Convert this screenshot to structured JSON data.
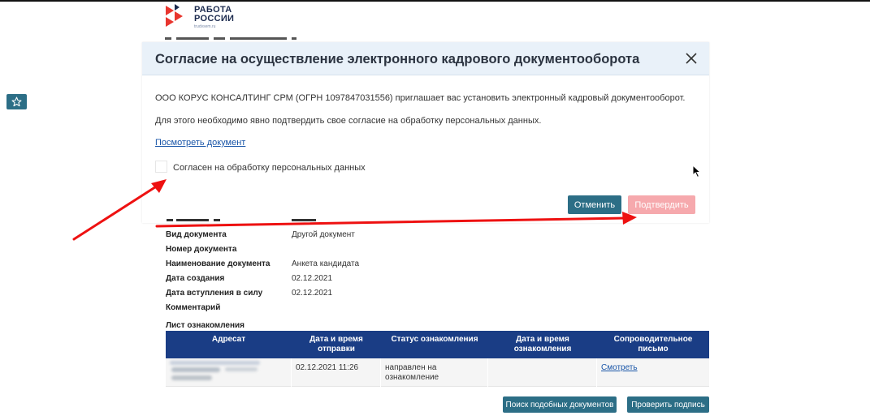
{
  "logo": {
    "line1": "РАБОТА",
    "line2": "РОССИИ",
    "sub": "trudvsem.ru"
  },
  "modal": {
    "title": "Согласие на осуществление электронного кадрового документооборота",
    "line1": "ООО КОРУС КОНСАЛТИНГ СРМ (ОГРН 1097847031556) приглашает вас установить электронный кадровый документооборот.",
    "line2": "Для этого необходимо явно подтвердить свое согласие на обработку персональных данных.",
    "link": "Посмотреть документ",
    "checkbox_label": "Согласен на обработку персональных данных",
    "checkbox_checked": false,
    "cancel_label": "Отменить",
    "confirm_label": "Подтвердить",
    "confirm_color": "#f6a9ad",
    "icons": [
      "close-icon",
      "star-icon",
      "mouse-cursor-icon"
    ]
  },
  "document": {
    "fields": [
      {
        "label": "Вид документа",
        "value": "Другой документ"
      },
      {
        "label": "Номер документа",
        "value": ""
      },
      {
        "label": "Наименование документа",
        "value": "Анкета кандидата"
      },
      {
        "label": "Дата создания",
        "value": "02.12.2021"
      },
      {
        "label": "Дата вступления в силу",
        "value": "02.12.2021"
      },
      {
        "label": "Комментарий",
        "value": ""
      }
    ]
  },
  "acquaintance": {
    "title": "Лист ознакомления",
    "columns": [
      "Адресат",
      "Дата и время\nотправки",
      "Статус ознакомления",
      "Дата и время\nознакомления",
      "Сопроводительное\nписьмо"
    ],
    "rows": [
      {
        "sent": "02.12.2021 11:26",
        "status": "направлен на\nознакомление",
        "read": "",
        "letter": "Смотреть"
      }
    ]
  },
  "footer": {
    "search_label": "Поиск подобных документов",
    "verify_label": "Проверить подпись"
  },
  "colors": {
    "accent": "#2c6e86",
    "table_header": "#1a3d85",
    "modal_header": "#e9f1f9",
    "annotation_arrow": "#ee1111"
  }
}
